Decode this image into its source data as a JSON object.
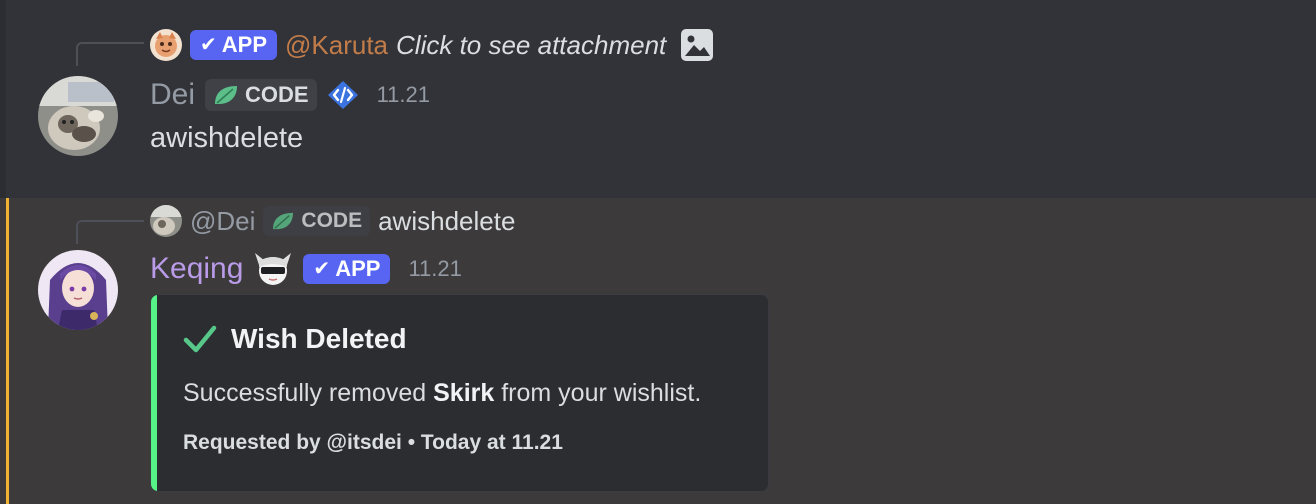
{
  "messages": [
    {
      "reply": {
        "badge": "APP",
        "mention": "@Karuta",
        "text": "Click to see attachment",
        "attachment_icon": "image-icon",
        "mention_color": "#c27c49"
      },
      "author": {
        "name": "Dei",
        "name_color": "#949ba4",
        "tag": "CODE",
        "tag_icon": "leaf-icon",
        "extra_icon": "code-brackets-icon",
        "timestamp": "11.21"
      },
      "content": "awishdelete"
    },
    {
      "reply": {
        "mention": "@Dei",
        "tag": "CODE",
        "tag_icon": "leaf-icon",
        "text": "awishdelete"
      },
      "author": {
        "name": "Keqing",
        "name_color": "#b99be8",
        "badge": "APP",
        "timestamp": "11.21"
      },
      "embed": {
        "accent_color": "#57f287",
        "title": "Wish Deleted",
        "title_icon": "checkmark-icon",
        "description_prefix": "Successfully removed",
        "description_bold": "Skirk",
        "description_suffix": "from your wishlist.",
        "footer": "Requested by @itsdei • Today at 11.21"
      },
      "highlight_color": "#f0b232"
    }
  ]
}
